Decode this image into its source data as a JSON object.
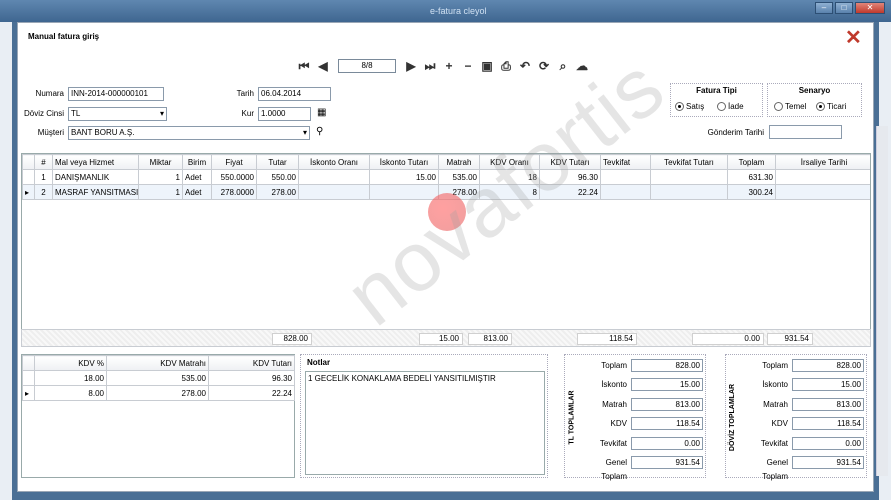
{
  "app": {
    "bg_title": "e-fatura cleyol"
  },
  "dialog": {
    "title": "Manual fatura giriş"
  },
  "toolbar": {
    "pager": "8/8"
  },
  "form": {
    "numara_label": "Numara",
    "numara": "INN-2014-000000101",
    "doviz_label": "Döviz Cinsi",
    "doviz": "TL",
    "musteri_label": "Müşteri",
    "musteri": "BANT BORU A.Ş.",
    "tarih_label": "Tarih",
    "tarih": "06.04.2014",
    "kur_label": "Kur",
    "kur": "1.0000",
    "gonderim_label": "Gönderim Tarihi",
    "gonderim": ""
  },
  "fatura_tipi": {
    "title": "Fatura Tipi",
    "satis": "Satış",
    "iade": "İade",
    "selected": "satis"
  },
  "senaryo": {
    "title": "Senaryo",
    "temel": "Temel",
    "ticari": "Ticari",
    "selected": "ticari"
  },
  "grid": {
    "columns": [
      "#",
      "Mal veya Hizmet",
      "Miktar",
      "Birim",
      "Fiyat",
      "Tutar",
      "İskonto Oranı",
      "İskonto Tutarı",
      "Matrah",
      "KDV Oranı",
      "KDV Tutarı",
      "Tevkifat",
      "Tevkifat Tutarı",
      "Toplam",
      "İrsaliye Tarihi"
    ],
    "rows": [
      [
        "1",
        "DANIŞMANLIK",
        "1",
        "Adet",
        "550.0000",
        "550.00",
        "",
        "15.00",
        "535.00",
        "18",
        "96.30",
        "",
        "",
        "631.30",
        ""
      ],
      [
        "2",
        "MASRAF YANSITMASI",
        "1",
        "Adet",
        "278.0000",
        "278.00",
        "",
        "",
        "278.00",
        "8",
        "22.24",
        "",
        "",
        "300.24",
        ""
      ]
    ],
    "totals": {
      "tutar": "828.00",
      "iskonto": "15.00",
      "matrah": "813.00",
      "kdv": "118.54",
      "tevkifat": "0.00",
      "toplam": "931.54"
    }
  },
  "kdv_table": {
    "columns": [
      "KDV %",
      "KDV Matrahı",
      "KDV Tutarı"
    ],
    "rows": [
      [
        "18.00",
        "535.00",
        "96.30"
      ],
      [
        "8.00",
        "278.00",
        "22.24"
      ]
    ]
  },
  "notes": {
    "title": "Notlar",
    "text": "1 GECELİK KONAKLAMA BEDELİ YANSITILMIŞTIR"
  },
  "tl_totals": {
    "title": "TL TOPLAMLAR",
    "labels": [
      "Toplam",
      "İskonto",
      "Matrah",
      "KDV",
      "Tevkifat",
      "Genel Toplam"
    ],
    "values": [
      "828.00",
      "15.00",
      "813.00",
      "118.54",
      "0.00",
      "931.54"
    ]
  },
  "doviz_totals": {
    "title": "DÖVİZ TOPLAMLAR",
    "labels": [
      "Toplam",
      "İskonto",
      "Matrah",
      "KDV",
      "Tevkifat",
      "Genel Toplam"
    ],
    "values": [
      "828.00",
      "15.00",
      "813.00",
      "118.54",
      "0.00",
      "931.54"
    ]
  },
  "watermark": "novafortis"
}
